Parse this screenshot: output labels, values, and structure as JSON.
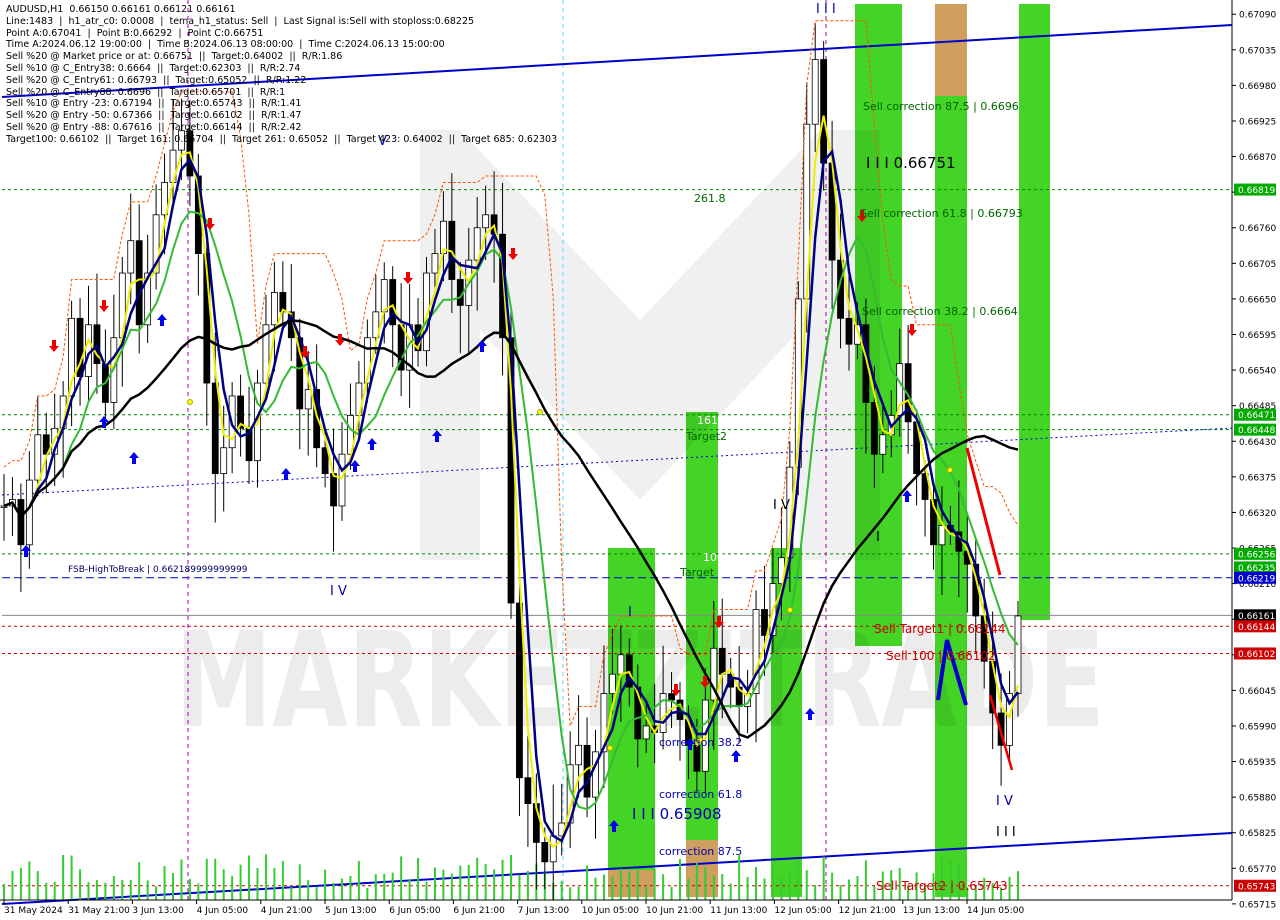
{
  "header": {
    "lines": [
      "AUDUSD,H1  0.66150 0.66161 0.66121 0.66161",
      "Line:1483  |  h1_atr_c0: 0.0008  |  tema_h1_status: Sell  |  Last Signal is:Sell with stoploss:0.68225",
      "Point A:0.67041  |  Point B:0.66292  |  Point C:0.66751",
      "Time A:2024.06.12 19:00:00  |  Time B:2024.06.13 08:00:00  |  Time C:2024.06.13 15:00:00",
      "Sell %20 @ Market price or at: 0.66751  ||  Target:0.64002  ||  R/R:1.86",
      "Sell %10 @ C_Entry38: 0.6664  ||  Target:0.62303  ||  R/R:2.74",
      "Sell %20 @ C_Entry61: 0.66793  ||  Target:0.65052  ||  R/R:1.22",
      "Sell %20 @ C_Entry88: 0.6696  ||  Target:0.65701  ||  R/R:1",
      "Sell %10 @ Entry -23: 0.67194  ||  Target:0.65743  ||  R/R:1.41",
      "Sell %20 @ Entry -50: 0.67366  ||  Target:0.66102  ||  R/R:1.47",
      "Sell %20 @ Entry -88: 0.67616  ||  Target:0.66144  ||  R/R:2.42",
      "Target100: 0.66102  ||  Target 161: 0.65704  ||  Target 261: 0.65052  ||  Target 423: 0.64002  ||  Target 685: 0.62303"
    ]
  },
  "watermark": {
    "text": "MARKETZITRADE"
  },
  "colors": {
    "green_zone": "#22cc00",
    "orange_zone": "#e8956a",
    "blue_line": "#0000cc",
    "dark_blue": "#000080",
    "yellow": "#eeee00",
    "mid_green": "#33bb33",
    "black_ma": "#000000",
    "orange_dash": "#ff5500",
    "level_green": "#008800",
    "level_red": "#cc0000",
    "bg": "#ffffff"
  },
  "chart_data": {
    "type": "candlestick",
    "symbol": "AUDUSD",
    "timeframe": "H1",
    "ylim": [
      0.65721,
      0.67112
    ],
    "y_ticks": [
      "0.67090",
      "0.67035",
      "0.66980",
      "0.66925",
      "0.66870",
      "0.66815",
      "0.66760",
      "0.66705",
      "0.66650",
      "0.66595",
      "0.66540",
      "0.66485",
      "0.66430",
      "0.66375",
      "0.66320",
      "0.66265",
      "0.66210",
      "0.66155",
      "0.66100",
      "0.66045",
      "0.65990",
      "0.65935",
      "0.65880",
      "0.65825",
      "0.65770",
      "0.65715"
    ],
    "x_labels": [
      "31 May 2024",
      "31 May 21:00",
      "3 Jun 13:00",
      "4 Jun 05:00",
      "4 Jun 21:00",
      "5 Jun 13:00",
      "6 Jun 05:00",
      "6 Jun 21:00",
      "7 Jun 13:00",
      "10 Jun 05:00",
      "10 Jun 21:00",
      "11 Jun 13:00",
      "12 Jun 05:00",
      "12 Jun 21:00",
      "13 Jun 13:00",
      "14 Jun 05:00"
    ],
    "price_tags": [
      {
        "value": 0.66819,
        "text": "0.66819",
        "color": "#00aa00"
      },
      {
        "value": 0.66471,
        "text": "0.66471",
        "color": "#00aa00"
      },
      {
        "value": 0.66448,
        "text": "0.66448",
        "color": "#00aa00"
      },
      {
        "value": 0.66256,
        "text": "0.66256",
        "color": "#00aa00"
      },
      {
        "value": 0.66235,
        "text": "0.66235",
        "color": "#00aa00"
      },
      {
        "value": 0.66219,
        "text": "0.66219",
        "color": "#0000cc"
      },
      {
        "value": 0.66161,
        "text": "0.66161",
        "color": "#000000"
      },
      {
        "value": 0.66144,
        "text": "0.66144",
        "color": "#cc0000"
      },
      {
        "value": 0.66102,
        "text": "0.66102",
        "color": "#cc0000"
      },
      {
        "value": 0.65743,
        "text": "0.65743",
        "color": "#cc0000"
      }
    ],
    "annotations": [
      {
        "text": "Sell correction 87.5 | 0.6696",
        "color": "#006600"
      },
      {
        "text": "I I I 0.66751",
        "color": "#000000"
      },
      {
        "text": "Sell correction 61.8 | 0.66793",
        "color": "#006600"
      },
      {
        "text": "Sell correction 38.2 | 0.6664",
        "color": "#006600"
      },
      {
        "text": "261.8",
        "color": "#006600"
      },
      {
        "text": "161.8",
        "color": "#ffffff"
      },
      {
        "text": "Target2",
        "color": "#006600"
      },
      {
        "text": "100",
        "color": "#ffffff"
      },
      {
        "text": "Target",
        "color": "#006600"
      },
      {
        "text": "FSB-HighToBreak  |  0.662189999999999",
        "color": "#000066"
      },
      {
        "text": "I V",
        "color": "#0000aa"
      },
      {
        "text": "I V",
        "color": "#000000"
      },
      {
        "text": "I",
        "color": "#000000"
      },
      {
        "text": "I",
        "color": "#0000aa"
      },
      {
        "text": "correction 38.2",
        "color": "#0000aa"
      },
      {
        "text": "correction 61.8",
        "color": "#0000aa"
      },
      {
        "text": "correction 87.5",
        "color": "#0000aa"
      },
      {
        "text": "I I I 0.65908",
        "color": "#0000aa"
      },
      {
        "text": "Sell Target1 | 0.66144",
        "color": "#cc0000"
      },
      {
        "text": "Sell 100 | 0.66102",
        "color": "#cc0000"
      },
      {
        "text": "Sell Target2 | 0.65743",
        "color": "#cc0000"
      },
      {
        "text": "I V",
        "color": "#0000aa"
      },
      {
        "text": "I I I",
        "color": "#000000"
      },
      {
        "text": "I I I",
        "color": "#0000aa"
      },
      {
        "text": "V",
        "color": "#0000aa"
      }
    ],
    "series": [
      {
        "name": "close",
        "values": [
          0.6633,
          0.6634,
          0.6627,
          0.6637,
          0.6644,
          0.6641,
          0.6645,
          0.665,
          0.6662,
          0.6653,
          0.6661,
          0.6655,
          0.6649,
          0.6659,
          0.6669,
          0.6674,
          0.6661,
          0.6669,
          0.6678,
          0.6683,
          0.6688,
          0.6691,
          0.6684,
          0.6672,
          0.6652,
          0.6638,
          0.6642,
          0.665,
          0.6645,
          0.664,
          0.6652,
          0.6661,
          0.6666,
          0.6663,
          0.6659,
          0.6648,
          0.6651,
          0.6642,
          0.6638,
          0.6633,
          0.6641,
          0.6647,
          0.6652,
          0.6659,
          0.6663,
          0.6668,
          0.6661,
          0.6654,
          0.6661,
          0.6657,
          0.6669,
          0.6672,
          0.6677,
          0.6668,
          0.6664,
          0.6671,
          0.6676,
          0.6678,
          0.6675,
          0.6659,
          0.6618,
          0.6591,
          0.6587,
          0.6581,
          0.6578,
          0.6582,
          0.6584,
          0.6593,
          0.6596,
          0.6588,
          0.6595,
          0.6604,
          0.6607,
          0.661,
          0.6605,
          0.6597,
          0.6599,
          0.6598,
          0.6604,
          0.6603,
          0.66,
          0.6596,
          0.6592,
          0.6603,
          0.6611,
          0.6607,
          0.6605,
          0.6602,
          0.6604,
          0.6617,
          0.6613,
          0.6621,
          0.6625,
          0.6639,
          0.6665,
          0.6692,
          0.6702,
          0.6686,
          0.6671,
          0.6662,
          0.6658,
          0.6661,
          0.6649,
          0.6641,
          0.6644,
          0.6647,
          0.6655,
          0.6646,
          0.6638,
          0.6634,
          0.6627,
          0.663,
          0.6629,
          0.6626,
          0.6624,
          0.6616,
          0.6609,
          0.6601,
          0.6596,
          0.6604,
          0.6616
        ]
      }
    ]
  }
}
